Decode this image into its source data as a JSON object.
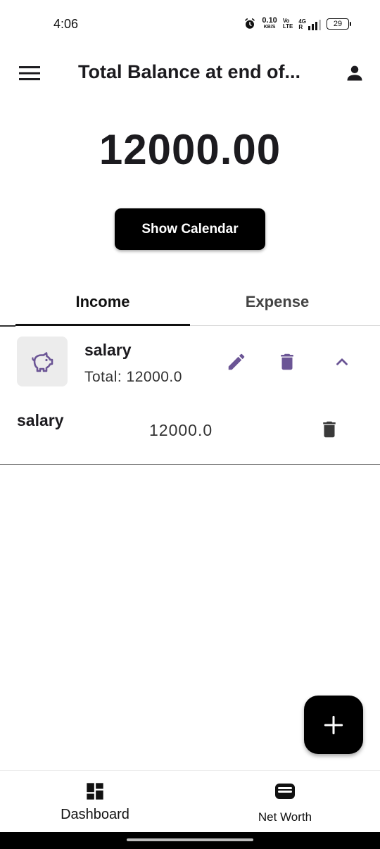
{
  "status_bar": {
    "time": "4:06",
    "net_speed_value": "0.10",
    "net_speed_unit": "KB/S",
    "volte_top": "Vo",
    "volte_bottom": "LTE",
    "network_top": "4G",
    "network_bottom": "R",
    "battery": "29"
  },
  "app_bar": {
    "title": "Total Balance at end of...",
    "menu_icon": "menu-icon",
    "account_icon": "account-icon"
  },
  "balance": "12000.00",
  "calendar_button": "Show Calendar",
  "tabs": [
    {
      "label": "Income",
      "selected": true
    },
    {
      "label": "Expense",
      "selected": false
    }
  ],
  "category": {
    "icon": "piggy-bank-icon",
    "name": "salary",
    "total": "Total: 12000.0",
    "accent_color": "#6b5595",
    "entries": [
      {
        "name": "salary",
        "amount": "12000.0"
      }
    ]
  },
  "fab": {
    "icon": "plus-icon"
  },
  "bottom_nav": [
    {
      "label": "Dashboard",
      "icon": "dashboard-icon"
    },
    {
      "label": "Net Worth",
      "icon": "wallet-icon"
    }
  ]
}
